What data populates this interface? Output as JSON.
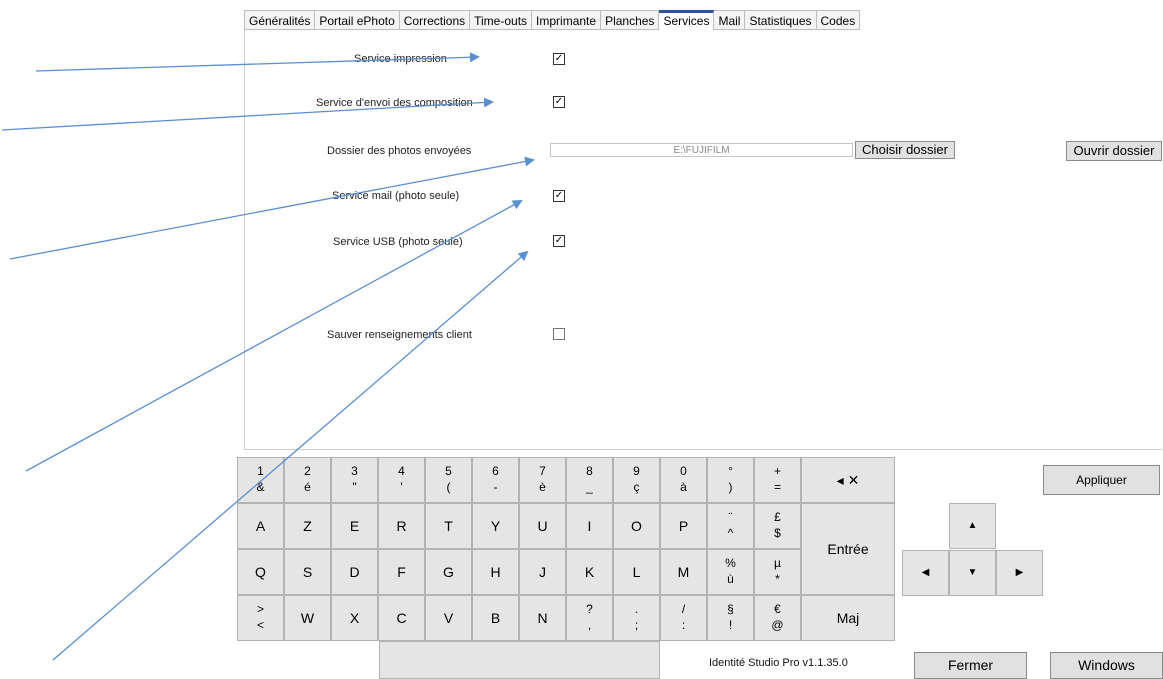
{
  "tabs": [
    {
      "label": "Généralités"
    },
    {
      "label": "Portail ePhoto"
    },
    {
      "label": "Corrections"
    },
    {
      "label": "Time-outs"
    },
    {
      "label": "Imprimante"
    },
    {
      "label": "Planches"
    },
    {
      "label": "Services"
    },
    {
      "label": "Mail"
    },
    {
      "label": "Statistiques"
    },
    {
      "label": "Codes"
    }
  ],
  "services": {
    "print_label": "Service impression",
    "compositions_label": "Service d'envoi des composition",
    "folder_label": "Dossier des photos envoyées",
    "folder_value": "E:\\FUJIFILM",
    "choose_folder": "Choisir dossier",
    "open_folder": "Ouvrir dossier",
    "mail_label": "Service mail (photo seule)",
    "usb_label": "Service USB (photo seule)",
    "save_client_label": "Sauver renseignements client",
    "check_mark": "✓"
  },
  "keyboard": {
    "row1": [
      [
        "1",
        "&"
      ],
      [
        "2",
        "é"
      ],
      [
        "3",
        "\""
      ],
      [
        "4",
        "'"
      ],
      [
        "5",
        "("
      ],
      [
        "6",
        "-"
      ],
      [
        "7",
        "è"
      ],
      [
        "8",
        "_"
      ],
      [
        "9",
        "ç"
      ],
      [
        "0",
        "à"
      ],
      [
        "°",
        ")"
      ],
      [
        "+",
        "="
      ]
    ],
    "backspace": "◂ ✕",
    "row2": [
      "A",
      "Z",
      "E",
      "R",
      "T",
      "Y",
      "U",
      "I",
      "O",
      "P"
    ],
    "row2_special": [
      [
        "¨",
        "^"
      ],
      [
        "£",
        "$"
      ]
    ],
    "enter": "Entrée",
    "row3": [
      "Q",
      "S",
      "D",
      "F",
      "G",
      "H",
      "J",
      "K",
      "L",
      "M"
    ],
    "row3_special": [
      [
        "%",
        "ù"
      ],
      [
        "µ",
        "*"
      ]
    ],
    "row4_first": [
      ">",
      "<"
    ],
    "row4": [
      "W",
      "X",
      "C",
      "V",
      "B",
      "N"
    ],
    "row4_special": [
      [
        "?",
        ","
      ],
      [
        ".",
        ";"
      ],
      [
        "/",
        ":"
      ],
      [
        "§",
        "!"
      ],
      [
        "€",
        "@"
      ]
    ],
    "shift": "Maj"
  },
  "arrows": {
    "up": "▲",
    "left": "◀",
    "down": "▼",
    "right": "▶"
  },
  "apply": "Appliquer",
  "close": "Fermer",
  "windows": "Windows",
  "version": "Identité Studio Pro  v1.1.35.0"
}
